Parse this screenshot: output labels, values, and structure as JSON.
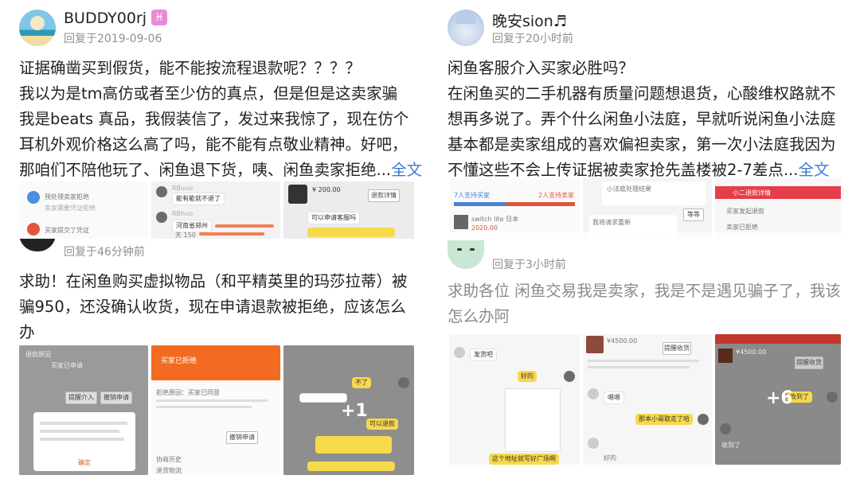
{
  "posts": [
    {
      "username": "BUDDY00rj",
      "zodiac_icon": "pisces-icon",
      "reply_time": "回复于2019-09-06",
      "lines": [
        "证据确凿买到假货，能不能按流程退款呢？？？？",
        "我以为是tm高仿或者至少仿的真点，但是但是这卖家骗",
        "我是beats 真品，我假装信了，发过来我惊了，现在仿个",
        "耳机外观价格这么高了吗，能不能有点敬业精神。好吧，",
        "那咱们不陪他玩了、闲鱼退下货，咦、闲鱼卖家拒绝..."
      ],
      "full_text_link": "全文",
      "thumbs": [
        {
          "items": [
            "预处理卖家拒绝",
            "卖家需要凭证拒绝",
            "买家提交了凭证"
          ]
        },
        {
          "items": [
            "RBuuo",
            "能有能就不退了",
            "RBhuo",
            "河南省郑州",
            "天 150"
          ]
        },
        {
          "price": "¥ 200.00",
          "button": "退款详情",
          "items": [
            "可以申请客服吗"
          ]
        }
      ]
    },
    {
      "username": "",
      "reply_time": "回复于46分钟前",
      "lines": [
        "求助！在闲鱼购买虚拟物品（和平精英里的玛莎拉蒂）被",
        "骗950，还没确认收货，现在申请退款被拒绝，应该怎么",
        "办"
      ],
      "thumbs": [
        {
          "items": [
            "退款原因",
            "买家已申请",
            "提醒介入",
            "撤销申请",
            "确定"
          ]
        },
        {
          "header": "买家已拒绝",
          "items": [
            "拒绝原因：买家已同意",
            "撤销申请",
            "协商历史",
            "退货物流"
          ]
        },
        {
          "more_count": "+1",
          "items": [
            "不了",
            "可以退款"
          ]
        }
      ]
    },
    {
      "username": "晚安sion♬",
      "reply_time": "回复于20小时前",
      "lines": [
        "闲鱼客服介入买家必胜吗？",
        "在闲鱼买的二手机器有质量问题想退货，心酸维权路就不",
        "想再多说了。弄个什么闲鱼小法庭，早就听说闲鱼小法庭",
        "基本都是卖家组成的喜欢偏袒卖家，第一次小法庭我因为",
        "不懂这些不会上传证据被卖家抢先盖楼被2-7差点..."
      ],
      "full_text_link": "全文",
      "thumbs": [
        {
          "items": [
            "7人支持买家",
            "2人支持卖家",
            "switch lite 日本",
            "2020.00"
          ]
        },
        {
          "items": [
            "小法庭处理结果",
            "等等",
            "我将请求重新"
          ]
        },
        {
          "header": "小二退款详情",
          "items": [
            "买家发起退款",
            "卖家已拒绝"
          ]
        }
      ]
    },
    {
      "username": "",
      "reply_time": "回复于3小时前",
      "lines": [
        "求助各位 闲鱼交易我是卖家，我是不是遇见骗子了，我该",
        "怎么办阿"
      ],
      "thumbs": [
        {
          "items": [
            "发货吧",
            "好的",
            "这个地址就写好广场啊"
          ]
        },
        {
          "price": "¥4500.00",
          "button": "提醒收货",
          "items": [
            "嗯嗯",
            "那本小哥取走了哈",
            "好的"
          ]
        },
        {
          "price": "¥4500.00",
          "button": "提醒收货",
          "more_count": "+6",
          "items": [
            "收到了",
            "收到了"
          ]
        }
      ]
    }
  ]
}
